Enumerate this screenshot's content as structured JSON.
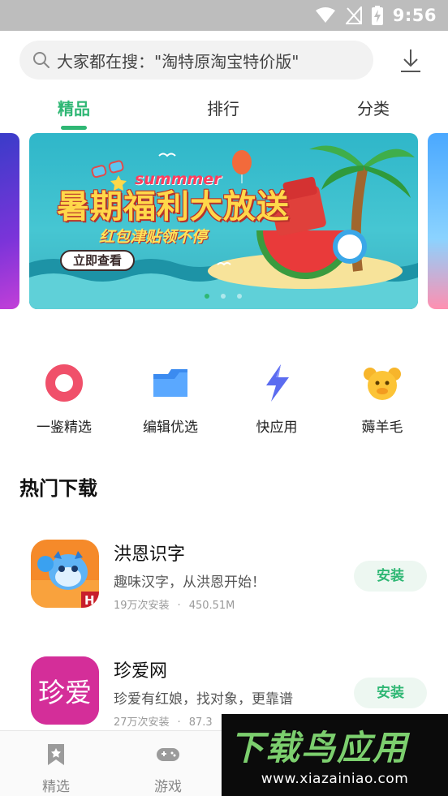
{
  "status_bar": {
    "time": "9:56"
  },
  "search": {
    "text": "大家都在搜：\"淘特原淘宝特价版\""
  },
  "tabs": [
    {
      "label": "精品",
      "active": true
    },
    {
      "label": "排行",
      "active": false
    },
    {
      "label": "分类",
      "active": false
    }
  ],
  "banner": {
    "headline": "暑期福利大放送",
    "english": "summmer",
    "subtitle": "红包津贴领不停",
    "cta": "立即查看",
    "pages": 3,
    "active_page": 1
  },
  "shortcuts": [
    {
      "label": "一鉴精选",
      "icon": "ring-icon"
    },
    {
      "label": "编辑优选",
      "icon": "folder-icon"
    },
    {
      "label": "快应用",
      "icon": "lightning-icon"
    },
    {
      "label": "薅羊毛",
      "icon": "sheep-icon"
    }
  ],
  "section": {
    "title": "热门下载"
  },
  "apps": [
    {
      "name": "洪恩识字",
      "desc": "趣味汉字，从洪恩开始！",
      "installs": "19万次安装",
      "size": "450.51M",
      "action": "安装",
      "icon": "tiger-icon"
    },
    {
      "name": "珍爱网",
      "desc": "珍爱有红娘，找对象，更靠谱",
      "installs": "27万次安装",
      "size": "87.3",
      "action": "安装",
      "icon": "zhenai-icon",
      "icon_text": "珍爱"
    }
  ],
  "bottom_nav": [
    {
      "label": "精选",
      "icon": "bookmark-star-icon"
    },
    {
      "label": "游戏",
      "icon": "gamepad-icon"
    }
  ],
  "watermark": {
    "title": "下载鸟应用",
    "url": "www.xiazainiao.com"
  },
  "colors": {
    "accent": "#2fb774",
    "status_bar": "#bdbdbd"
  }
}
